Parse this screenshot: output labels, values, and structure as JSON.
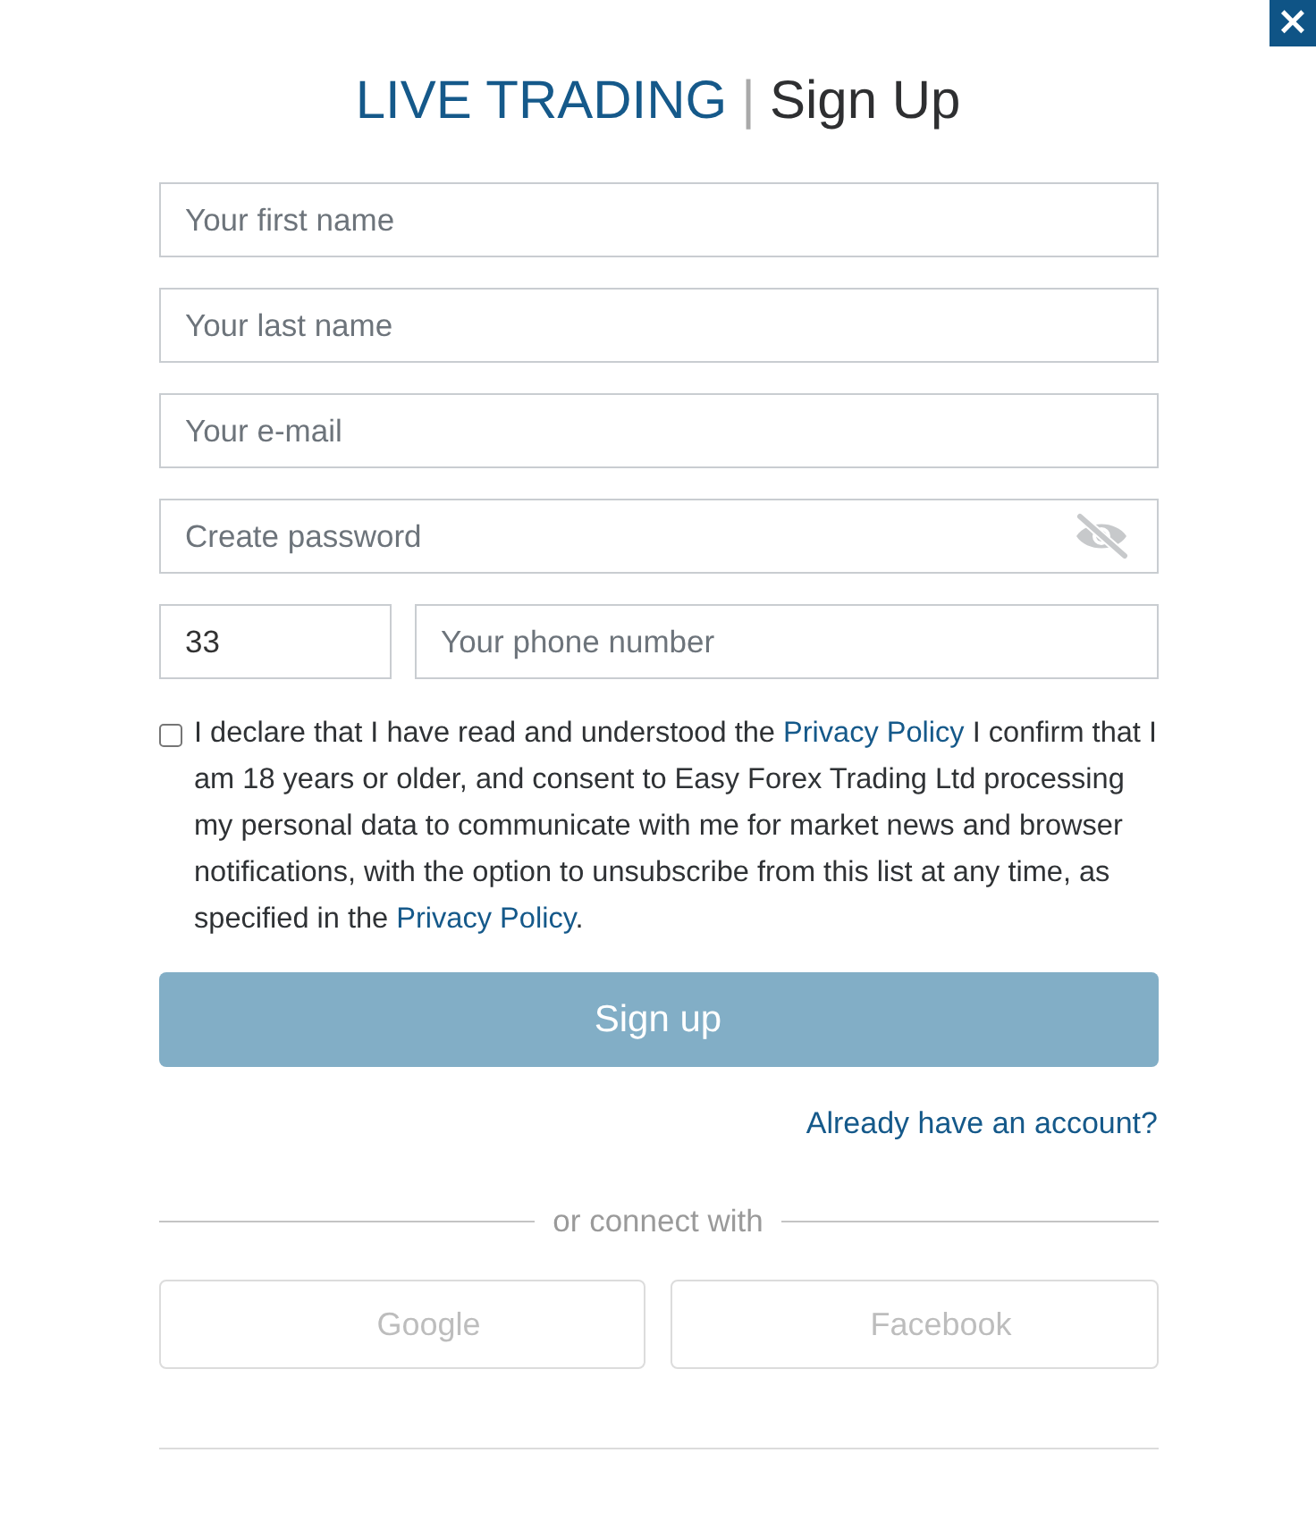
{
  "close_button": {
    "label": "×"
  },
  "title": {
    "brand": "LIVE TRADING",
    "separator": "|",
    "page": "Sign Up"
  },
  "fields": [
    {
      "kind": "text",
      "placeholder": "Your first name"
    },
    {
      "kind": "text",
      "placeholder": "Your last name"
    },
    {
      "kind": "email",
      "placeholder": "Your e-mail"
    },
    {
      "kind": "password",
      "placeholder": "Create password"
    }
  ],
  "phone": {
    "code": "33",
    "placeholder": "Your phone number"
  },
  "consent": {
    "checked": false,
    "parts": [
      {
        "kind": "text",
        "text": "I declare that I have read and understood the "
      },
      {
        "kind": "link",
        "text": "Privacy Policy"
      },
      {
        "kind": "text",
        "text": " I confirm that I am 18 years or older, and consent to Easy Forex Trading Ltd processing my personal data to communicate with me for market news and browser notifications, with the option to unsubscribe from this list at any time, as specified in the "
      },
      {
        "kind": "link",
        "text": "Privacy Policy"
      },
      {
        "kind": "text",
        "text": "."
      }
    ]
  },
  "submit_button": {
    "label": "Sign up",
    "disabled": true
  },
  "login_link": "Already have an account?",
  "divider_text": "or connect with",
  "social_buttons": [
    {
      "label": "Google"
    },
    {
      "label": "Facebook"
    }
  ]
}
